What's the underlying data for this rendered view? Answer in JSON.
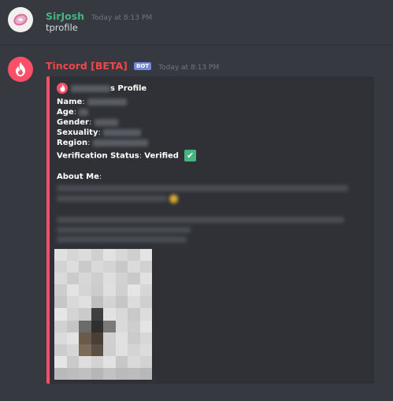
{
  "messages": [
    {
      "author": "SirJosh",
      "author_color": "#43b581",
      "timestamp": "Today at 8:13 PM",
      "text": "tprofile"
    },
    {
      "author": "Tincord [BETA]",
      "author_color": "#f04747",
      "badge": "BOT",
      "timestamp": "Today at 8:13 PM"
    }
  ],
  "embed": {
    "accent_color": "#fd5068",
    "title_suffix": "s Profile",
    "fields": {
      "name_label": "Name",
      "age_label": "Age",
      "gender_label": "Gender",
      "sexuality_label": "Sexuality",
      "region_label": "Region",
      "verification_label": "Verification Status",
      "verification_value": "Verified",
      "about_label": "About Me"
    },
    "icons": {
      "title_icon": "flame-icon",
      "verified_icon": "checkmark-icon"
    }
  }
}
